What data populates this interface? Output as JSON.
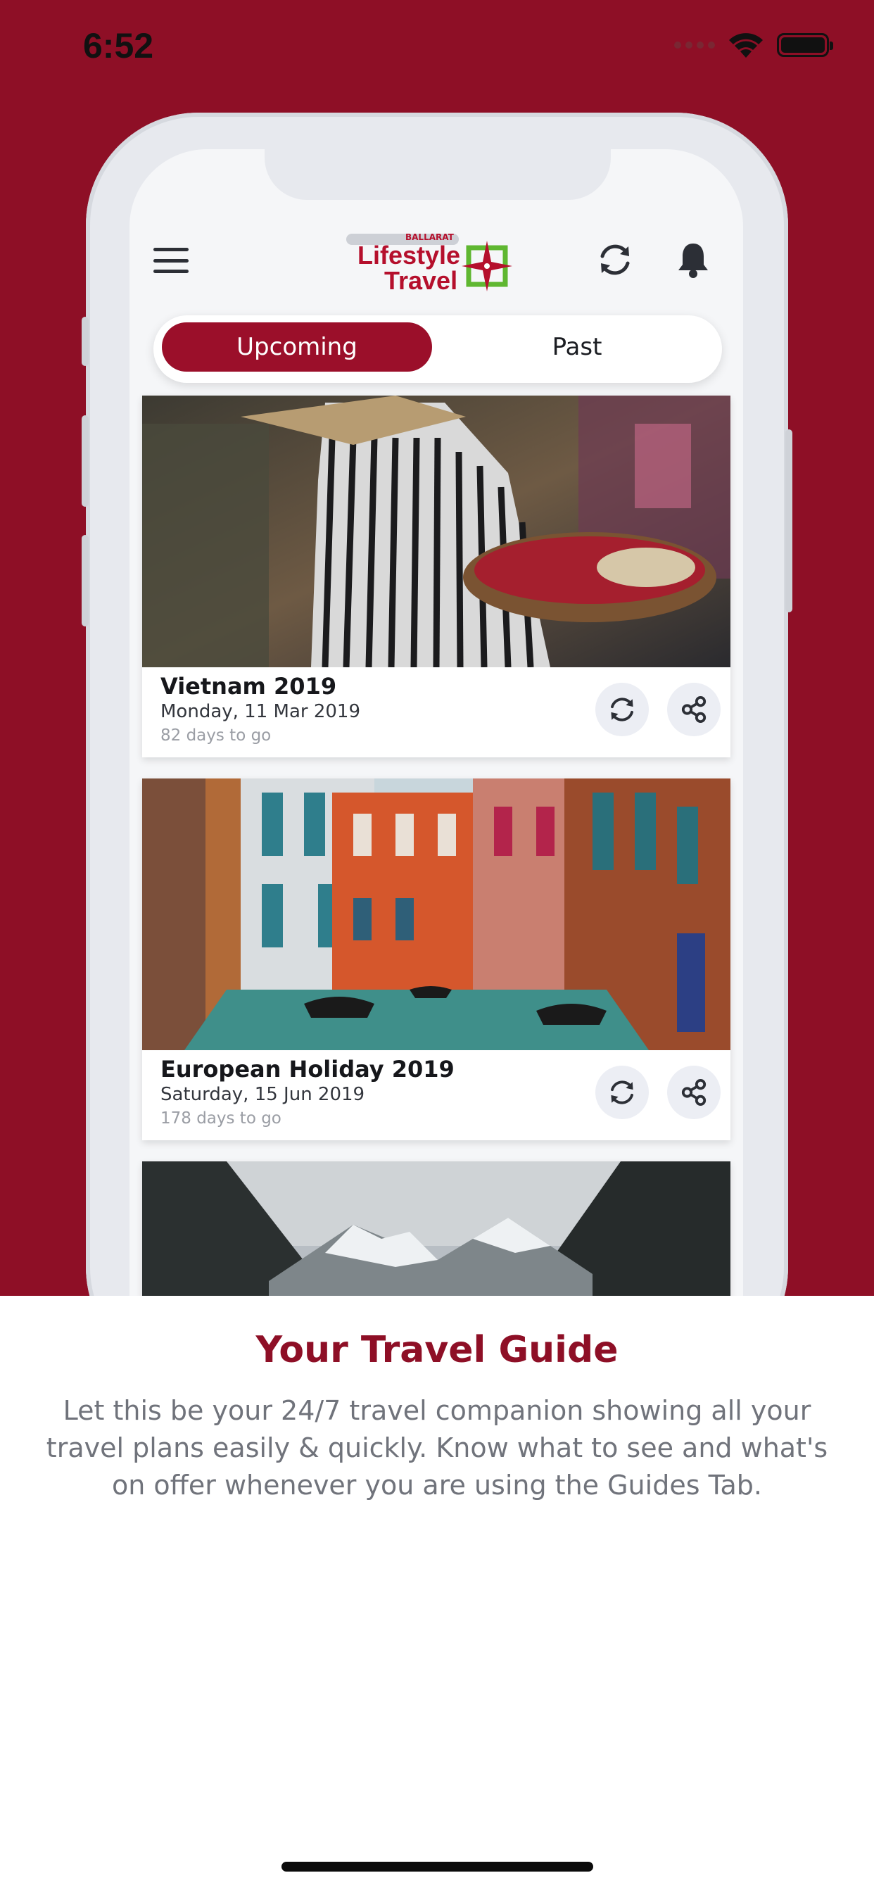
{
  "status_bar": {
    "time": "6:52"
  },
  "app": {
    "logo": {
      "small": "BALLARAT",
      "line1": "Lifestyle",
      "line2": "Travel"
    },
    "tabs": [
      {
        "label": "Upcoming",
        "active": true
      },
      {
        "label": "Past",
        "active": false
      }
    ],
    "trips": [
      {
        "title": "Vietnam 2019",
        "date": "Monday, 11 Mar 2019",
        "countdown": "82 days to go"
      },
      {
        "title": "European Holiday 2019",
        "date": "Saturday, 15 Jun 2019",
        "countdown": "178 days to go"
      }
    ]
  },
  "onboarding": {
    "title": "Your Travel Guide",
    "description": "Let this be your 24/7 travel companion showing all your travel plans easily & quickly. Know what to see and what's on offer whenever you are using the Guides Tab."
  },
  "colors": {
    "brand_red": "#8e0f26",
    "accent_red": "#9b0f2a",
    "logo_green": "#5fb731",
    "text_gray": "#70737b"
  }
}
